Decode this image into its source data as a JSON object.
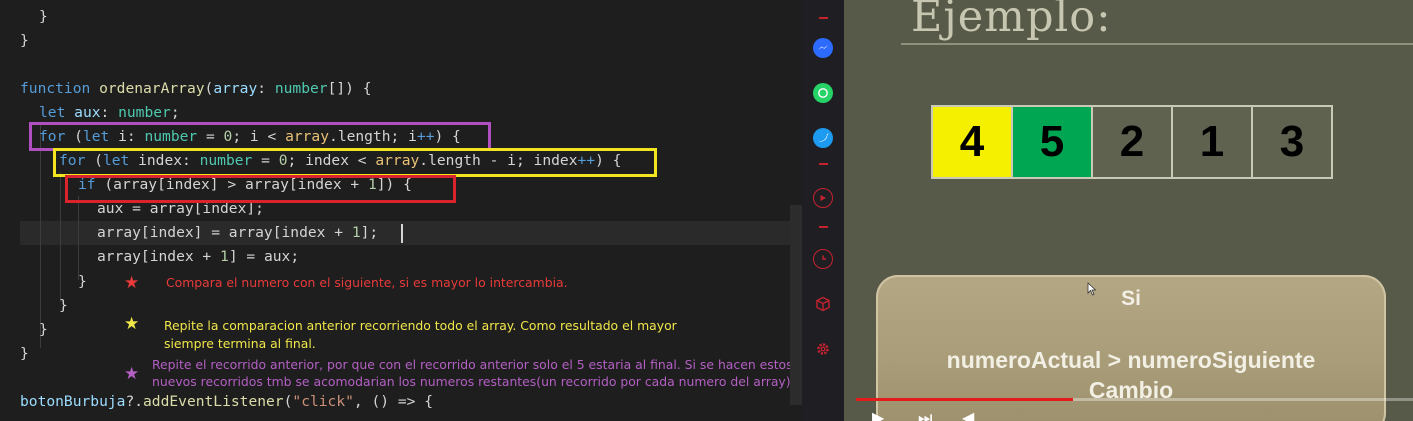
{
  "editor": {
    "line_close_inner_brace": "}",
    "line_close_outer_brace": "}",
    "line_function": [
      "function",
      "ordenarArray",
      "(",
      "array",
      ": ",
      "number",
      "[]) {"
    ],
    "line_let_aux": [
      "let",
      "aux",
      ": ",
      "number",
      ";"
    ],
    "line_for_outer": {
      "kw_for": "for",
      "kw_let": "let",
      "var": "i",
      "type": "number",
      "zero": "0",
      "cond_var": "i",
      "array": "array",
      "length": "length",
      "inc_var": "i",
      "inc_op": "++"
    },
    "line_for_inner": {
      "kw_for": "for",
      "kw_let": "let",
      "var": "index",
      "type": "number",
      "zero": "0",
      "cond_var": "index",
      "array": "array",
      "length": "length",
      "minus_i": "i",
      "inc_var": "index",
      "inc_op": "++"
    },
    "line_if": {
      "kw": "if",
      "text": "(array[index] > array[index + ",
      "one": "1",
      "end": "]) {"
    },
    "line_aux_assign": "aux = array[index];",
    "line_swap1": {
      "a": "array[index] = array[index + ",
      "one": "1",
      "b": "];"
    },
    "line_swap2": {
      "a": "array[index + ",
      "one": "1",
      "b": "] = aux;"
    },
    "closing_braces": [
      "}",
      "}",
      "}",
      "}"
    ],
    "line_listener": {
      "obj": "botonBurbuja",
      "q": "?.",
      "method": "addEventListener",
      "open": "(",
      "str": "\"click\"",
      "rest": ", () => {"
    },
    "colors": {
      "purple_box": "#b04fc0",
      "yellow_box": "#f2e41e",
      "red_box": "#d9232d"
    },
    "notes": {
      "red": "Compara el numero con el siguiente, si es mayor lo intercambia.",
      "yellow_1": "Repite la comparacion anterior recorriendo todo el array. Como resultado el mayor",
      "yellow_2": "siempre termina al final.",
      "purple_1": "Repite el recorrido anterior, por que con el recorrido anterior solo el 5 estaria al final. Si se hacen estos",
      "purple_2": "nuevos recorridos tmb se acomodarian los numeros restantes(un recorrido por cada numero del array)."
    },
    "note_colors": {
      "red": "#e83a3a",
      "yellow": "#f1e64a",
      "purple": "#b45fc4"
    },
    "star_glyph": "★"
  },
  "sidebar": {
    "icons": [
      "messenger-icon",
      "whatsapp-icon",
      "twitter-icon",
      "play-circle-icon",
      "clock-icon",
      "cube-icon",
      "settings-icon"
    ]
  },
  "video": {
    "title": "Ejemplo:",
    "cells": [
      {
        "value": "4",
        "color": "#f5f000"
      },
      {
        "value": "5",
        "color": "#00a651"
      },
      {
        "value": "2",
        "color": "#5f624f"
      },
      {
        "value": "1",
        "color": "#5f624f"
      },
      {
        "value": "3",
        "color": "#5f624f"
      }
    ],
    "card": {
      "title": "Si",
      "line1": "numeroActual > numeroSiguiente",
      "line2": "Cambio"
    },
    "progress_fraction": 0.39
  }
}
